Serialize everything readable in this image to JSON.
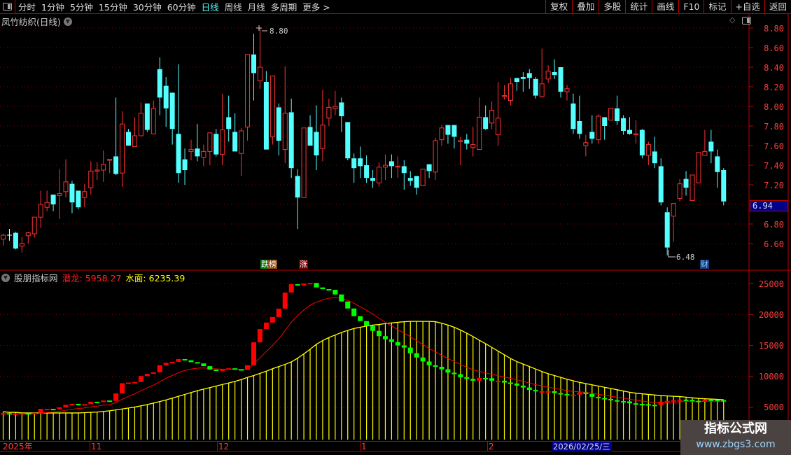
{
  "toolbar": {
    "periods": [
      "分时",
      "1分钟",
      "5分钟",
      "15分钟",
      "30分钟",
      "60分钟",
      "日线",
      "周线",
      "月线",
      "多周期",
      "更多 >"
    ],
    "active_period": "日线",
    "buttons": [
      "复权",
      "叠加",
      "多股",
      "统计",
      "画线",
      "F10",
      "标记",
      "+自选",
      "返回"
    ]
  },
  "main": {
    "title": "凤竹纺织(日线)",
    "y_ticks": [
      "8.80",
      "8.60",
      "8.40",
      "8.20",
      "8.00",
      "7.80",
      "7.60",
      "7.40",
      "7.20",
      "6.80",
      "6.60"
    ],
    "current_price": "6.94",
    "high_marker": "8.80",
    "low_marker": "6.48",
    "badges": {
      "dragon": "跌榜",
      "rise": "涨",
      "finance": "财"
    }
  },
  "indicator": {
    "name": "股朋指标网",
    "qianlong_label": "潜龙:",
    "qianlong_value": "5958.27",
    "shuimian_label": "水面:",
    "shuimian_value": "6235.39",
    "y_ticks": [
      "25000",
      "20000",
      "15000",
      "10000",
      "5000"
    ]
  },
  "date_axis": {
    "labels": [
      "2025年",
      "11",
      "12",
      "1",
      "2"
    ],
    "selected": "2026/02/25/三"
  },
  "watermark": {
    "title": "指标公式网",
    "url": "www.zbgs3.com"
  },
  "colors": {
    "up": "#ff3232",
    "down": "#54ffff",
    "qianlong_up": "#ff0000",
    "qianlong_down": "#00ff00",
    "shuimian": "#ffff00",
    "ma": "#ff0000",
    "accent": "#c00000"
  },
  "chart_data": [
    {
      "type": "candlestick",
      "ylim": [
        6.48,
        8.8
      ],
      "fields": [
        "open",
        "high",
        "low",
        "close"
      ],
      "candles": [
        [
          6.645,
          6.7,
          6.58,
          6.686
        ],
        [
          6.686,
          6.75,
          6.63,
          6.686
        ],
        [
          6.71,
          6.72,
          6.54,
          6.55
        ],
        [
          6.575,
          6.67,
          6.51,
          6.6
        ],
        [
          6.68,
          6.72,
          6.6,
          6.71
        ],
        [
          6.7,
          6.87,
          6.66,
          6.87
        ],
        [
          6.87,
          7.14,
          6.76,
          7.0
        ],
        [
          6.97,
          7.14,
          6.93,
          7.02
        ],
        [
          7.1,
          7.1,
          6.93,
          7.0
        ],
        [
          7.09,
          7.36,
          6.85,
          7.11
        ],
        [
          7.13,
          7.46,
          7.07,
          7.23
        ],
        [
          7.21,
          7.24,
          6.91,
          7.02
        ],
        [
          7.14,
          7.14,
          6.95,
          6.97
        ],
        [
          7.07,
          7.21,
          6.97,
          7.13
        ],
        [
          7.17,
          7.44,
          7.1,
          7.34
        ],
        [
          7.34,
          7.43,
          7.25,
          7.35
        ],
        [
          7.35,
          7.55,
          7.23,
          7.41
        ],
        [
          7.45,
          7.46,
          7.32,
          7.46
        ],
        [
          7.49,
          8.09,
          7.3,
          7.31
        ],
        [
          7.32,
          7.95,
          7.18,
          7.82
        ],
        [
          7.74,
          7.77,
          7.6,
          7.6
        ],
        [
          7.59,
          7.89,
          7.59,
          7.7
        ],
        [
          7.7,
          8.04,
          7.7,
          7.93
        ],
        [
          8.03,
          8.03,
          7.74,
          7.76
        ],
        [
          7.72,
          8.06,
          7.72,
          7.98
        ],
        [
          8.38,
          8.5,
          7.91,
          8.09
        ],
        [
          8.21,
          8.3,
          7.79,
          7.98
        ],
        [
          8.14,
          8.14,
          7.61,
          7.77
        ],
        [
          7.72,
          8.43,
          7.22,
          7.32
        ],
        [
          7.46,
          7.57,
          7.2,
          7.35
        ],
        [
          7.54,
          7.66,
          7.45,
          7.56
        ],
        [
          7.57,
          7.82,
          7.44,
          7.49
        ],
        [
          7.48,
          7.61,
          7.39,
          7.54
        ],
        [
          7.54,
          7.73,
          7.4,
          7.73
        ],
        [
          7.72,
          7.77,
          7.49,
          7.51
        ],
        [
          7.51,
          8.13,
          7.4,
          7.76
        ],
        [
          7.89,
          8.11,
          7.64,
          7.77
        ],
        [
          7.74,
          7.93,
          7.54,
          7.54
        ],
        [
          7.52,
          7.78,
          7.29,
          7.75
        ],
        [
          7.79,
          8.53,
          7.65,
          8.53
        ],
        [
          8.53,
          8.74,
          8.06,
          8.34
        ],
        [
          8.26,
          8.8,
          8.18,
          8.4
        ],
        [
          8.25,
          8.36,
          7.56,
          7.56
        ],
        [
          7.69,
          8.31,
          7.61,
          8.31
        ],
        [
          7.99,
          8.03,
          7.5,
          7.65
        ],
        [
          7.56,
          8.41,
          7.42,
          7.93
        ],
        [
          7.94,
          8.08,
          7.27,
          7.37
        ],
        [
          7.29,
          7.36,
          6.75,
          7.07
        ],
        [
          7.07,
          7.78,
          7.07,
          7.78
        ],
        [
          7.79,
          7.91,
          7.6,
          7.6
        ],
        [
          7.74,
          8.01,
          7.35,
          7.5
        ],
        [
          7.57,
          8.17,
          7.44,
          7.81
        ],
        [
          7.88,
          8.08,
          7.8,
          7.99
        ],
        [
          7.98,
          8.16,
          7.91,
          8.0
        ],
        [
          8.04,
          8.09,
          7.74,
          7.9
        ],
        [
          7.84,
          7.84,
          7.45,
          7.47
        ],
        [
          7.47,
          7.52,
          7.22,
          7.37
        ],
        [
          7.47,
          7.59,
          7.27,
          7.39
        ],
        [
          7.4,
          7.5,
          7.22,
          7.27
        ],
        [
          7.27,
          7.35,
          7.17,
          7.24
        ],
        [
          7.22,
          7.43,
          7.18,
          7.38
        ],
        [
          7.38,
          7.51,
          7.25,
          7.4
        ],
        [
          7.44,
          7.51,
          7.27,
          7.39
        ],
        [
          7.38,
          7.49,
          7.27,
          7.39
        ],
        [
          7.39,
          7.45,
          7.15,
          7.32
        ],
        [
          7.27,
          7.34,
          7.19,
          7.24
        ],
        [
          7.29,
          7.29,
          7.1,
          7.17
        ],
        [
          7.19,
          7.36,
          7.19,
          7.36
        ],
        [
          7.41,
          7.41,
          7.27,
          7.34
        ],
        [
          7.33,
          7.68,
          7.25,
          7.65
        ],
        [
          7.66,
          7.81,
          7.6,
          7.78
        ],
        [
          7.81,
          7.81,
          7.62,
          7.71
        ],
        [
          7.81,
          7.81,
          7.57,
          7.69
        ],
        [
          7.64,
          7.69,
          7.4,
          7.65
        ],
        [
          7.66,
          7.72,
          7.56,
          7.62
        ],
        [
          7.58,
          7.79,
          7.49,
          7.61
        ],
        [
          7.56,
          8.09,
          7.56,
          7.89
        ],
        [
          7.89,
          8.01,
          7.76,
          7.77
        ],
        [
          7.83,
          8.05,
          7.77,
          7.96
        ],
        [
          7.71,
          8.25,
          7.6,
          7.88
        ],
        [
          8.1,
          8.22,
          8.07,
          8.11
        ],
        [
          8.06,
          8.29,
          8.01,
          8.23
        ],
        [
          8.29,
          8.29,
          8.16,
          8.25
        ],
        [
          8.3,
          8.35,
          8.15,
          8.28
        ],
        [
          8.34,
          8.38,
          8.18,
          8.29
        ],
        [
          8.28,
          8.3,
          8.08,
          8.11
        ],
        [
          8.1,
          8.59,
          8.09,
          8.23
        ],
        [
          8.28,
          8.42,
          8.24,
          8.36
        ],
        [
          8.35,
          8.48,
          8.28,
          8.32
        ],
        [
          8.4,
          8.4,
          8.09,
          8.15
        ],
        [
          8.15,
          8.22,
          8.06,
          8.18
        ],
        [
          8.03,
          8.13,
          7.72,
          7.77
        ],
        [
          7.85,
          8.11,
          7.67,
          7.72
        ],
        [
          7.6,
          7.71,
          7.49,
          7.63
        ],
        [
          7.74,
          7.91,
          7.62,
          7.67
        ],
        [
          7.66,
          7.92,
          7.62,
          7.9
        ],
        [
          7.89,
          7.89,
          7.66,
          7.8
        ],
        [
          7.86,
          7.98,
          7.86,
          7.98
        ],
        [
          7.98,
          8.11,
          7.81,
          7.85
        ],
        [
          7.88,
          7.91,
          7.71,
          7.75
        ],
        [
          7.76,
          7.89,
          7.71,
          7.72
        ],
        [
          7.71,
          7.86,
          7.62,
          7.72
        ],
        [
          7.76,
          7.77,
          7.47,
          7.5
        ],
        [
          7.5,
          7.64,
          7.4,
          7.61
        ],
        [
          7.54,
          7.69,
          7.37,
          7.42
        ],
        [
          7.39,
          7.47,
          6.99,
          7.02
        ],
        [
          6.92,
          6.97,
          6.48,
          6.56
        ],
        [
          6.88,
          7.01,
          6.62,
          7.01
        ],
        [
          7.06,
          7.26,
          7.03,
          7.21
        ],
        [
          7.26,
          7.34,
          7.09,
          7.17
        ],
        [
          7.04,
          7.3,
          7.04,
          7.3
        ],
        [
          7.22,
          7.53,
          7.22,
          7.53
        ],
        [
          7.5,
          7.76,
          7.5,
          7.54
        ],
        [
          7.64,
          7.76,
          7.42,
          7.54
        ],
        [
          7.49,
          7.56,
          7.17,
          7.33
        ],
        [
          7.35,
          7.37,
          6.99,
          7.03
        ]
      ]
    },
    {
      "type": "bar+line",
      "ylim": [
        0,
        26000
      ],
      "series": [
        {
          "name": "潜龙",
          "values": [
            3950,
            3900,
            3900,
            3950,
            3900,
            4000,
            4650,
            4650,
            4600,
            4900,
            5300,
            5450,
            5300,
            5400,
            5800,
            5750,
            6000,
            5950,
            7150,
            8800,
            8900,
            9000,
            9950,
            10300,
            10550,
            11700,
            12100,
            12250,
            12700,
            12500,
            12200,
            12000,
            11550,
            11000,
            10800,
            11000,
            11200,
            11050,
            10950,
            11700,
            15400,
            17550,
            18600,
            19500,
            20850,
            23450,
            24800,
            24600,
            24900,
            25000,
            24270,
            24000,
            23890,
            23140,
            22000,
            20870,
            19630,
            18840,
            18050,
            17250,
            16400,
            15900,
            15450,
            14900,
            14550,
            13650,
            12950,
            12300,
            11700,
            11450,
            11050,
            10500,
            10250,
            9750,
            9500,
            9200,
            9650,
            9600,
            9200,
            9200,
            8900,
            8750,
            8400,
            8100,
            7700,
            7500,
            7500,
            7500,
            7200,
            7050,
            6850,
            6950,
            7300,
            7050,
            6600,
            6400,
            6250,
            6050,
            5900,
            5850,
            5550,
            5450,
            5400,
            5300,
            5250,
            5800,
            5950,
            6050,
            6150,
            6100,
            5950,
            5900,
            6150,
            6100,
            6050,
            5958.27
          ]
        },
        {
          "name": "水面",
          "values": [
            4300,
            4200,
            4200,
            4100,
            4100,
            4100,
            4100,
            4100,
            4100,
            4100,
            4100,
            4100,
            4100,
            4150,
            4200,
            4250,
            4350,
            4450,
            4600,
            4750,
            4900,
            5050,
            5250,
            5450,
            5700,
            5950,
            6200,
            6500,
            6800,
            7100,
            7400,
            7700,
            7950,
            8200,
            8450,
            8700,
            8950,
            9200,
            9500,
            9850,
            10150,
            10500,
            10850,
            11250,
            11600,
            11950,
            12350,
            12950,
            13650,
            14400,
            15200,
            15800,
            16300,
            16700,
            17100,
            17450,
            17750,
            17950,
            18150,
            18300,
            18400,
            18550,
            18650,
            18750,
            18850,
            18900,
            18900,
            18900,
            18900,
            18850,
            18600,
            18300,
            17950,
            17500,
            17000,
            16450,
            15850,
            15300,
            14700,
            14100,
            13500,
            12900,
            12400,
            12000,
            11600,
            11200,
            10800,
            10450,
            10150,
            9850,
            9550,
            9300,
            9050,
            8850,
            8650,
            8450,
            8250,
            8050,
            7850,
            7650,
            7450,
            7300,
            7200,
            7100,
            7000,
            6900,
            6850,
            6800,
            6750,
            6650,
            6550,
            6450,
            6400,
            6350,
            6300,
            6235.39
          ]
        }
      ]
    }
  ]
}
